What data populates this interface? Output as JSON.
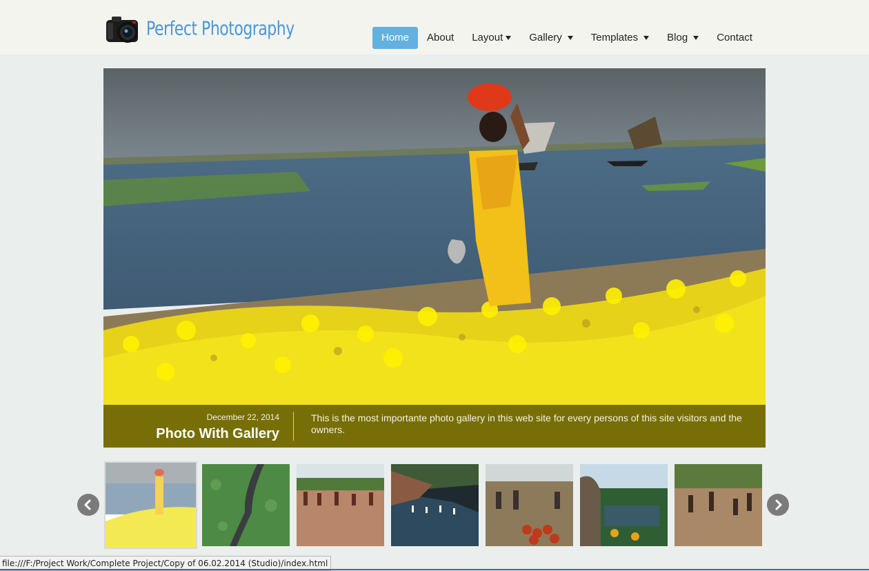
{
  "brand": {
    "name": "Perfect Photography"
  },
  "nav": {
    "items": [
      {
        "label": "Home",
        "active": true,
        "dropdown": false
      },
      {
        "label": "About",
        "active": false,
        "dropdown": false
      },
      {
        "label": "Layout",
        "active": false,
        "dropdown": true
      },
      {
        "label": "Gallery",
        "active": false,
        "dropdown": true
      },
      {
        "label": "Templates",
        "active": false,
        "dropdown": true
      },
      {
        "label": "Blog",
        "active": false,
        "dropdown": true
      },
      {
        "label": "Contact",
        "active": false,
        "dropdown": false
      }
    ]
  },
  "slide": {
    "date": "December 22, 2014",
    "title": "Photo With Gallery",
    "description": "This is the most importante photo gallery in this web site for every persons of this site visitors and the owners."
  },
  "thumbnails": {
    "count": 7,
    "active_index": 0
  },
  "status_bar": {
    "url": "file:///F:/Project Work/Complete Project/Copy of 06.02.2014 (Studio)/index.html"
  },
  "colors": {
    "accent": "#64b0de",
    "brand": "#4a97d6",
    "caption_bg": "#464100"
  }
}
